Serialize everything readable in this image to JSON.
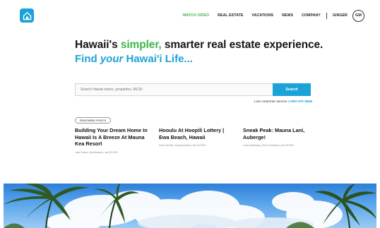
{
  "header": {
    "logo_icon": "house-icon",
    "nav": [
      {
        "label": "WATCH VIDEO",
        "accent": true
      },
      {
        "label": "REAL ESTATE"
      },
      {
        "label": "VACATIONS"
      },
      {
        "label": "NEWS"
      },
      {
        "label": "COMPANY"
      }
    ],
    "user_name": "GINGER",
    "avatar_initials": "GM"
  },
  "hero": {
    "headline_pre": "Hawaii's ",
    "headline_accent": "simpler,",
    "headline_post": " smarter real estate experience.",
    "subhead_pre": "Find ",
    "subhead_em": "your",
    "subhead_post": " Hawai'i Life..."
  },
  "search": {
    "placeholder": "Search Hawaii towns, properties, MLS#",
    "button_label": "Search",
    "service_text": "Live customer service",
    "service_phone": "1-800-370-3848"
  },
  "featured": {
    "tag_label": "FEATURED POSTS",
    "posts": [
      {
        "title": "Building Your Dream Home In Hawaii Is A Breeze At Mauna Kea Resort",
        "meta": "Jane Doerer | Architecture | Jan 28 2020"
      },
      {
        "title": "Hooulu At Hoopili Lottery | Ewa Beach, Hawaii",
        "meta": "Dave Sennler | Buying Advice | Jan 25 2020"
      },
      {
        "title": "Sneak Peak: Mauna Lani, Auberge!",
        "meta": "Lena Katchinsky | Hot & Featured | Jan 25 2020"
      }
    ]
  },
  "colors": {
    "brand_blue": "#1aa3d8",
    "accent_green": "#3cb54a"
  }
}
